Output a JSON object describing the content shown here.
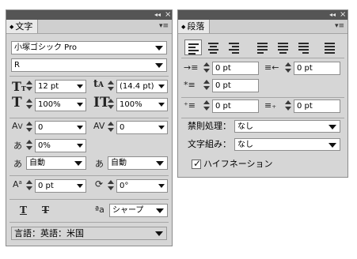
{
  "window_controls": {
    "collapse": "◂◂",
    "close": "×"
  },
  "character_panel": {
    "tab_label": "文字",
    "font_family": "小塚ゴシック Pro",
    "font_style": "R",
    "font_size": "12 pt",
    "leading": "(14.4 pt)",
    "vertical_scale": "100%",
    "horizontal_scale": "100%",
    "kerning": "0",
    "tracking": "0",
    "tsume": "0%",
    "mojikumi_before": "自動",
    "mojikumi_after": "自動",
    "baseline_shift": "0 pt",
    "rotation": "0°",
    "antialias_prefix": "ªa",
    "antialias": "シャープ",
    "language": "言語：英語：米国"
  },
  "paragraph_panel": {
    "tab_label": "段落",
    "left_indent": "0 pt",
    "right_indent": "0 pt",
    "first_line_indent": "0 pt",
    "space_before": "0 pt",
    "space_after": "0 pt",
    "kinsoku_label": "禁則処理：",
    "kinsoku_value": "なし",
    "mojikumi_label": "文字組み：",
    "mojikumi_value": "なし",
    "hyphenation_label": "ハイフネーション",
    "hyphenation_checked": true
  }
}
